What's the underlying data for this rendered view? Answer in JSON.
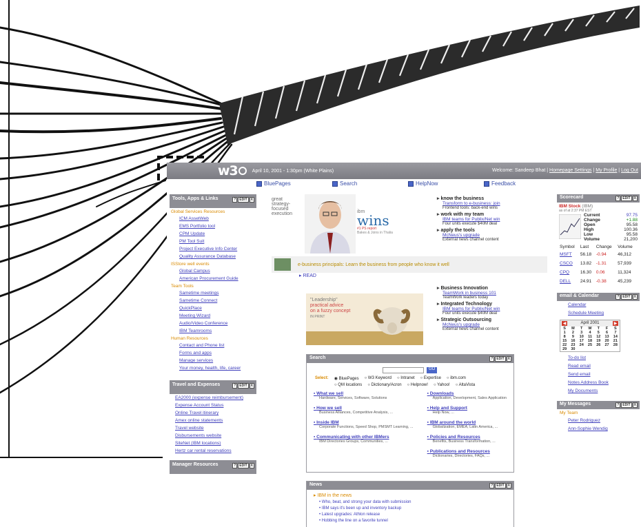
{
  "topbar": {
    "logo": "w3",
    "datetime": "April 10, 2001 - 1:30pm (White Plains)",
    "welcome": "Welcome: Sandeep Bhat",
    "links": [
      "Homepage Settings",
      "My Profile",
      "Log Out"
    ]
  },
  "nav": {
    "items": [
      "BluePages",
      "Search",
      "HelpNow",
      "Feedback"
    ]
  },
  "left": {
    "tools": {
      "title": "Tools, Apps & Links",
      "btn_labels": [
        "?",
        "EDIT",
        "X"
      ],
      "sections": [
        {
          "title": "Global Services Resources",
          "links": [
            "ICM AssetWeb",
            "EMS Portfolio tool",
            "CPM Update",
            "PM Tool Suit",
            "Project Executive Info Center",
            "Quality Assurance Database"
          ]
        },
        {
          "title": "ISStore well events",
          "links": [
            "Global Campus",
            "American Procurement Guide"
          ]
        },
        {
          "title": "Team Tools",
          "links": [
            "Sametime meetings",
            "Sametime Connect",
            "QuickPlace",
            "Meeting Wizard",
            "Audio/Video Conference",
            "IBM Teamrooms"
          ]
        },
        {
          "title": "Human Resources",
          "links": [
            "Contact and Phone list",
            "Forms and apps",
            "Manage services",
            "Your money, health, life, career"
          ]
        }
      ]
    },
    "travel": {
      "title": "Travel and Expenses",
      "links": [
        "EA2000 (expense reimbursement)",
        "Expense Account Status",
        "Online Travel itinerary",
        "Amex online statements",
        "Travel website",
        "Disbursements website",
        "SiteNet (IBM locations)",
        "Hertz car rental reservations"
      ]
    },
    "manager": {
      "title": "Manager Resources"
    }
  },
  "center": {
    "teaser": [
      "great",
      "strategy-",
      "focused",
      "execution"
    ],
    "wins_img": {
      "a": "ibm",
      "b": "wins",
      "c": "#1 PS report",
      "d": "Bakes & Joins in Thalia"
    },
    "wins": [
      {
        "head": "know the business",
        "link": "Transform to e-business: join",
        "text": "Frontend tools: back-end wins"
      },
      {
        "head": "work with my team",
        "link": "IBM teams for Publix/Net win",
        "text": "Four units execute $40M deal"
      },
      {
        "head": "apply the tools",
        "link": "McNeus's upgrade",
        "text": "External news channel content"
      }
    ],
    "banner": "e-business principals: Learn the business from people who know it well",
    "read": "READ",
    "ram_text": [
      "\"Leadership\"",
      "practical advice",
      "on a fuzzy concept",
      "IN PRINT"
    ],
    "business": [
      {
        "head": "Business Innovation",
        "link": "TeamWork in business 101",
        "text": "TeamWork leaders today"
      },
      {
        "head": "Integrated Technology",
        "link": "IBM teams for Publix/Net win",
        "text": "Four units execute $40M deal"
      },
      {
        "head": "Strategic Outsourcing",
        "link": "McNeus's upgrade",
        "text": "External news channel content"
      }
    ],
    "search": {
      "title": "Search",
      "button": "GO",
      "scope_label": "Select:",
      "options_row1": [
        "BluePages",
        "W3 Keyword",
        "Intranet",
        "Expertise",
        "ibm.com"
      ],
      "options_row2": [
        "QM locations",
        "Dictionary/Acron",
        "Helpnow!",
        "Yahoo!",
        "AltaVista"
      ],
      "left": [
        {
          "t": "What we sell",
          "d": "Hardware, Services, Software, Solutions"
        },
        {
          "t": "How we sell",
          "d": "Business Alliances, Competitive Analysis, ..."
        },
        {
          "t": "Inside IBM",
          "d": "Corporate Functions, Speed Shop, PMSMT Learning, ..."
        },
        {
          "t": "Communicating with other IBMers",
          "d": "IBM Directories Groups, Communities, ..."
        }
      ],
      "right": [
        {
          "t": "Downloads",
          "d": "Application, Development, Sales Application"
        },
        {
          "t": "Help and Support",
          "d": "Help Now, ..."
        },
        {
          "t": "IBM around the world",
          "d": "Globalization, EMEA, Latin America, ..."
        },
        {
          "t": "Policies and Resources",
          "d": "Benefits, Business Transformation, ..."
        },
        {
          "t": "Publications and Resources",
          "d": "Dictionaries, Directories, FAQs, ..."
        }
      ]
    },
    "news": {
      "title": "News",
      "headline": "IBM in the news",
      "links": [
        "Who, beat, and strong your data with submission",
        "IBM says it's been up and inventory backup",
        "Latest upgrades: Athlon release",
        "Hobbing the line on a favorite tunnel"
      ]
    }
  },
  "right": {
    "scorecard": {
      "title": "Scorecard",
      "stock_label": "IBM Stock",
      "stock_ticker": "(IBM)",
      "asof": "as of at 2:37 PM EST",
      "rows": [
        {
          "k": "Current",
          "v": "97.75"
        },
        {
          "k": "Change",
          "v": "+1.88"
        },
        {
          "k": "Open",
          "v": "95.58"
        },
        {
          "k": "High",
          "v": "100.36"
        },
        {
          "k": "Low",
          "v": "95.58"
        },
        {
          "k": "Volume",
          "v": "21,200"
        }
      ],
      "quote_headers": [
        "Symbol",
        "Last",
        "Change",
        "Volume"
      ],
      "quotes": [
        [
          "MSFT",
          "56.18",
          "-0.94",
          "46,312"
        ],
        [
          "CSCO",
          "13.82",
          "-1.31",
          "57,939"
        ],
        [
          "CPQ",
          "16.30",
          "0.06",
          "11,324"
        ],
        [
          "DELL",
          "24.91",
          "-0.38",
          "45,239"
        ]
      ]
    },
    "email": {
      "title": "email & Calendar",
      "calendar_link": "Calendar",
      "schedule_link": "Schedule Meeting",
      "month": "April 2001",
      "dows": [
        "S",
        "M",
        "T",
        "W",
        "T",
        "F",
        "S"
      ],
      "days": [
        "1",
        "2",
        "3",
        "4",
        "5",
        "6",
        "7",
        "8",
        "9",
        "10",
        "11",
        "12",
        "13",
        "14",
        "15",
        "16",
        "17",
        "18",
        "19",
        "20",
        "21",
        "22",
        "23",
        "24",
        "25",
        "26",
        "27",
        "28",
        "29",
        "30"
      ],
      "links": [
        "To-do list",
        "Read email",
        "Send email",
        "Notes Address Book",
        "My Documents"
      ]
    },
    "messages": {
      "title": "My Messages",
      "team": "My Team",
      "members": [
        "Peter Rodriguez",
        "Ann-Sophie Wendig"
      ]
    }
  }
}
